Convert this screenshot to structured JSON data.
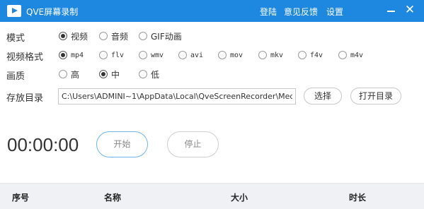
{
  "app": {
    "title": "QVE屏幕录制"
  },
  "menu": {
    "login": "登陆",
    "feedback": "意见反馈",
    "settings": "设置"
  },
  "window": {
    "minimize": "",
    "close": "✕"
  },
  "mode": {
    "label": "模式",
    "options": [
      "视频",
      "音频",
      "GIF动画"
    ],
    "selected": "视频"
  },
  "format": {
    "label": "视频格式",
    "options": [
      "mp4",
      "flv",
      "wmv",
      "avi",
      "mov",
      "mkv",
      "f4v",
      "m4v"
    ],
    "selected": "mp4"
  },
  "quality": {
    "label": "画质",
    "options": [
      "高",
      "中",
      "低"
    ],
    "selected": "中"
  },
  "output": {
    "label": "存放目录",
    "path": "C:\\Users\\ADMINI~1\\AppData\\Local\\QveScreenRecorder\\Med",
    "browse": "选择",
    "open": "打开目录"
  },
  "recorder": {
    "timer": "00:00:00",
    "start": "开始",
    "stop": "停止"
  },
  "table": {
    "columns": [
      "序号",
      "名称",
      "大小",
      "时长"
    ]
  }
}
